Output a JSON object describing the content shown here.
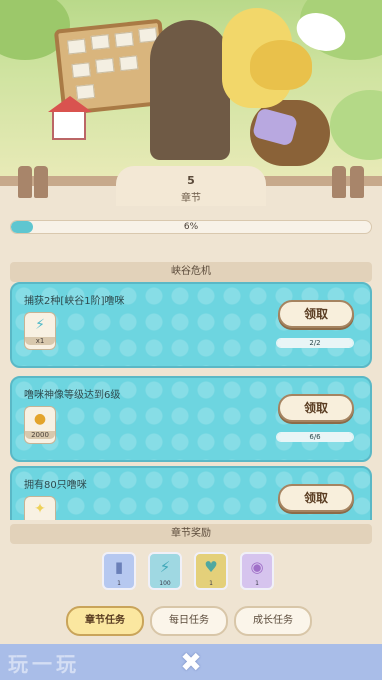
{
  "chapter": {
    "number": "5",
    "label": "章节",
    "progress_text": "6%",
    "progress_fraction": 0.06
  },
  "section_title": "峡谷危机",
  "quests": [
    {
      "title": "捕获2种[峡谷1阶]噜咪",
      "reward_icon": "lightning-icon",
      "reward_qty": "x1",
      "claim_label": "领取",
      "progress_text": "2/2",
      "progress_fraction": 1.0
    },
    {
      "title": "噜咪神像等级达到6级",
      "reward_icon": "coin-icon",
      "reward_qty": "2000",
      "claim_label": "领取",
      "progress_text": "6/6",
      "progress_fraction": 1.0
    },
    {
      "title": "拥有80只噜咪",
      "reward_icon": "puzzle-icon",
      "reward_qty": "",
      "claim_label": "领取",
      "progress_text": "",
      "progress_fraction": 1.0
    }
  ],
  "chapter_reward": {
    "title": "章节奖励",
    "items": [
      {
        "icon": "book-icon",
        "qty": "1"
      },
      {
        "icon": "lightning-icon",
        "qty": "100"
      },
      {
        "icon": "creature-icon",
        "qty": "1"
      },
      {
        "icon": "potion-icon",
        "qty": "1"
      }
    ]
  },
  "tabs": [
    {
      "label": "章节任务",
      "active": true
    },
    {
      "label": "每日任务",
      "active": false
    },
    {
      "label": "成长任务",
      "active": false
    }
  ],
  "colors": {
    "accent": "#6dd5e0",
    "bottom_bar": "#a9bde8"
  },
  "watermark": "玩一玩"
}
